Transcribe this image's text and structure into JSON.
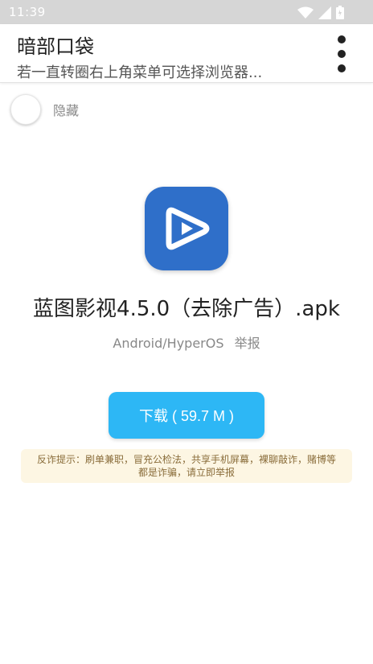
{
  "status_bar": {
    "time": "11:39"
  },
  "app_bar": {
    "title": "暗部口袋",
    "subtitle": "若一直转圈右上角菜单可选择浏览器..."
  },
  "hide_toggle": {
    "label": "隐藏"
  },
  "file": {
    "name": "蓝图影视4.5.0（去除广告）.apk",
    "platform": "Android/HyperOS",
    "report_label": "举报",
    "icon": "play-icon",
    "icon_color": "#2f6fc9"
  },
  "download": {
    "label": "下载 ( 59.7 M )",
    "color": "#2db7f5"
  },
  "warning": {
    "line1": "反诈提示：刷单兼职，冒充公检法，共享手机屏幕，裸聊敲诈，赌博等",
    "line2": "都是诈骗，请立即举报"
  }
}
